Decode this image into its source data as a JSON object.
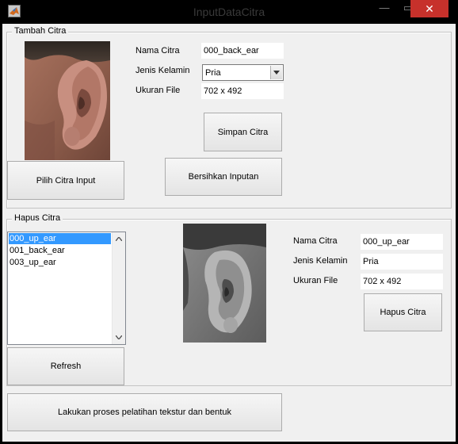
{
  "window": {
    "title": "InputDataCitra",
    "minimize_glyph": "—",
    "maximize_glyph": "▭",
    "close_glyph": "✕"
  },
  "add_group": {
    "legend": "Tambah Citra",
    "name_label": "Nama Citra",
    "name_value": "000_back_ear",
    "gender_label": "Jenis Kelamin",
    "gender_value": "Pria",
    "size_label": "Ukuran File",
    "size_value": "702 x 492",
    "save_button": "Simpan Citra",
    "clear_button": "Bersihkan Inputan",
    "pick_button": "Pilih Citra Input"
  },
  "delete_group": {
    "legend": "Hapus Citra",
    "list_items": [
      "000_up_ear",
      "001_back_ear",
      "003_up_ear"
    ],
    "selected_index": 0,
    "name_label": "Nama Citra",
    "name_value": "000_up_ear",
    "gender_label": "Jenis Kelamin",
    "gender_value": "Pria",
    "size_label": "Ukuran File",
    "size_value": "702 x 492",
    "delete_button": "Hapus Citra",
    "refresh_button": "Refresh"
  },
  "train_button": "Lakukan proses pelatihan tekstur dan bentuk",
  "colors": {
    "close_button": "#c7312b",
    "selection": "#3399ff",
    "panel_bg": "#f0f0f0"
  }
}
